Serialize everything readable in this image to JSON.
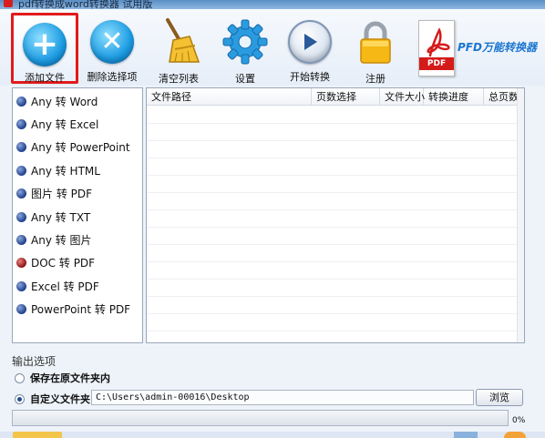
{
  "window": {
    "title": "pdf转换成word转换器 试用版"
  },
  "toolbar": {
    "add_file": "添加文件",
    "delete_selected": "删除选择项",
    "clear_list": "清空列表",
    "settings": "设置",
    "start_convert": "开始转换",
    "register": "注册",
    "brand": "PFD万能转换器",
    "pdf_badge": "PDF"
  },
  "conversion_types": [
    {
      "label": "Any 转 Word",
      "dot": "blue"
    },
    {
      "label": "Any 转 Excel",
      "dot": "blue"
    },
    {
      "label": "Any 转 PowerPoint",
      "dot": "blue"
    },
    {
      "label": "Any 转 HTML",
      "dot": "blue"
    },
    {
      "label": "图片 转 PDF",
      "dot": "blue"
    },
    {
      "label": "Any 转 TXT",
      "dot": "blue"
    },
    {
      "label": "Any 转 图片",
      "dot": "blue"
    },
    {
      "label": "DOC 转 PDF",
      "dot": "red"
    },
    {
      "label": "Excel 转 PDF",
      "dot": "blue"
    },
    {
      "label": "PowerPoint 转 PDF",
      "dot": "blue"
    }
  ],
  "table": {
    "columns": [
      "文件路径",
      "页数选择",
      "文件大小",
      "转换进度",
      "总页数"
    ]
  },
  "output": {
    "section_label": "输出选项",
    "option_same_folder": "保存在原文件夹内",
    "option_custom_folder": "自定义文件夹",
    "selected_option": "custom",
    "path_value": "C:\\Users\\admin-00016\\Desktop",
    "browse_label": "浏览"
  },
  "progress": {
    "value": 0,
    "label": "0%"
  },
  "colors": {
    "accent": "#1c9be2",
    "highlight_border": "#e11b1b",
    "pdf_red": "#d51a1a"
  }
}
